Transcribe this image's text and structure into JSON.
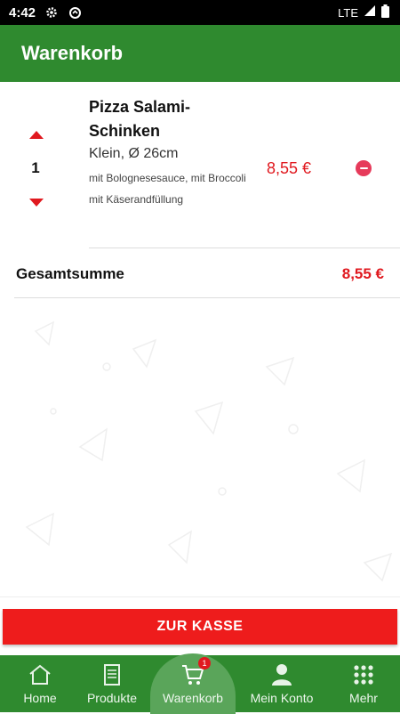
{
  "status_bar": {
    "time": "4:42",
    "network": "LTE",
    "icons": [
      "settings-icon",
      "data-saver-icon",
      "signal-icon",
      "battery-icon"
    ]
  },
  "app_bar": {
    "title": "Warenkorb"
  },
  "cart": {
    "items": [
      {
        "quantity": "1",
        "name": "Pizza Salami-Schinken",
        "size": "Klein, Ø 26cm",
        "extras": [
          "mit Bolognesesauce, mit Broccoli",
          "mit Käserandfüllung"
        ],
        "price": "8,55 €"
      }
    ],
    "total_label": "Gesamtsumme",
    "total_value": "8,55 €"
  },
  "checkout_button": "ZUR KASSE",
  "bottom_nav": {
    "items": [
      {
        "label": "Home",
        "icon": "home-icon"
      },
      {
        "label": "Produkte",
        "icon": "menu-card-icon"
      },
      {
        "label": "Warenkorb",
        "icon": "cart-icon",
        "badge": "1",
        "active": true
      },
      {
        "label": "Mein Konto",
        "icon": "person-icon"
      },
      {
        "label": "Mehr",
        "icon": "grid-icon"
      }
    ]
  },
  "colors": {
    "primary_green": "#2f8a2f",
    "accent_red": "#e0191f",
    "remove_pink": "#e63a5a"
  }
}
